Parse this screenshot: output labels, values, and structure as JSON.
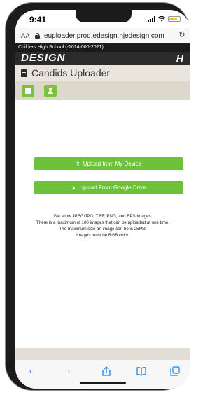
{
  "status": {
    "time": "9:41"
  },
  "browser": {
    "text_size": "AA",
    "url": "euploader.prod.edesign.hjedesign.com",
    "reload_icon": "reload-icon"
  },
  "site": {
    "school": "Childers High School (-1014-000-2021)",
    "brand_logo": "DESIGN",
    "brand_mark": "H",
    "page_title": "Candids Uploader"
  },
  "toolbar": {
    "btn1_icon": "file-icon",
    "btn2_icon": "user-icon"
  },
  "upload": {
    "device_label": "Upload from My Device",
    "drive_label": "Upload From Google Drive"
  },
  "info": {
    "line1": "We allow JPEG/JPG, TIFF, PNG, and EPS Images.",
    "line2": "There is a maximum of 100 images that can be uploaded at one time.",
    "line3": "The maximum size an image can be is 25MB.",
    "line4": "Images must be RGB color."
  },
  "colors": {
    "accent_green": "#6cc23a",
    "header_dark": "#2b2b2b",
    "ios_blue": "#1a7cf2"
  }
}
